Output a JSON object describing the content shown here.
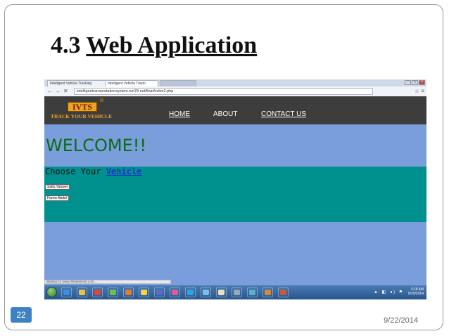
{
  "slide": {
    "title_number": "4.3",
    "title_text": "Web Application",
    "slide_number": "22",
    "date": "9/22/2014"
  },
  "browser": {
    "tabs": [
      {
        "label": "Intelligent Vehicle Tracking"
      },
      {
        "label": "Intelligent Vehicle Tracki"
      },
      {
        "label": ""
      }
    ],
    "nav_back": "←",
    "nav_forward": "→",
    "nav_stop": "✕",
    "url": "intelligentransportationsystem.net78.net/final/index2.php",
    "tool_star": "☆",
    "tool_menu": "≡",
    "status_text": "Waiting for www.000webhost.com..."
  },
  "site": {
    "logo_text": "IVTS",
    "logo_reg": "®",
    "logo_tagline": "TRACK YOUR VEHICLE",
    "menu": {
      "home": "HOME",
      "about": "ABOUT",
      "contact": "CONTACT US"
    },
    "welcome": "WELCOME!!",
    "choose_prefix": "Choose Your ",
    "choose_link": "Vehicle",
    "vehicles": [
      {
        "label": "Saifu Yatavel"
      },
      {
        "label": "Farew Abdul"
      }
    ]
  },
  "taskbar": {
    "tray_icons": "▲ ◧ ◂) ⚑",
    "time": "3:28 AM",
    "date": "9/20/2014",
    "apps": [
      {
        "name": "ie-icon",
        "color": "#3b8fe0"
      },
      {
        "name": "folder-icon",
        "color": "#e8c14a"
      },
      {
        "name": "chrome-icon",
        "color": "#d9483b"
      },
      {
        "name": "photos-icon",
        "color": "#6fbf4a"
      },
      {
        "name": "firefox-icon",
        "color": "#e87a2a"
      },
      {
        "name": "chat-icon",
        "color": "#f2d34a"
      },
      {
        "name": "media-icon",
        "color": "#5a6ad0"
      },
      {
        "name": "paint-icon",
        "color": "#e05a9a"
      },
      {
        "name": "skype-icon",
        "color": "#2aa6e0"
      },
      {
        "name": "notepad-icon",
        "color": "#7ac0e8"
      },
      {
        "name": "calendar-icon",
        "color": "#e8e0c0"
      },
      {
        "name": "settings-icon",
        "color": "#9aa8b8"
      },
      {
        "name": "network-icon",
        "color": "#5ab0c8"
      },
      {
        "name": "archive-icon",
        "color": "#d08a3a"
      },
      {
        "name": "tools-icon",
        "color": "#c85a3a"
      }
    ]
  }
}
